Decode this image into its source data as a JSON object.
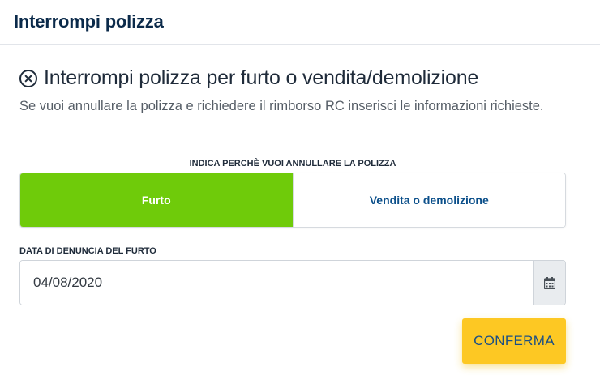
{
  "header": {
    "title": "Interrompi polizza"
  },
  "section": {
    "icon": "close-circle-icon",
    "title": "Interrompi polizza per furto o vendita/demolizione",
    "description": "Se vuoi annullare la polizza e richiedere il rimborso RC inserisci le informazioni richieste."
  },
  "reason": {
    "label": "INDICA PERCHÈ VUOI ANNULLARE LA POLIZZA",
    "options": [
      {
        "label": "Furto",
        "selected": true
      },
      {
        "label": "Vendita o demolizione",
        "selected": false
      }
    ]
  },
  "date": {
    "label": "DATA DI DENUNCIA DEL FURTO",
    "value": "04/08/2020",
    "icon": "calendar-icon"
  },
  "actions": {
    "confirm_label": "CONFERMA"
  },
  "colors": {
    "accent_green": "#6fcb0a",
    "confirm_yellow": "#fdc823",
    "link_blue": "#0b4f8a",
    "title_navy": "#0b2a4a"
  }
}
